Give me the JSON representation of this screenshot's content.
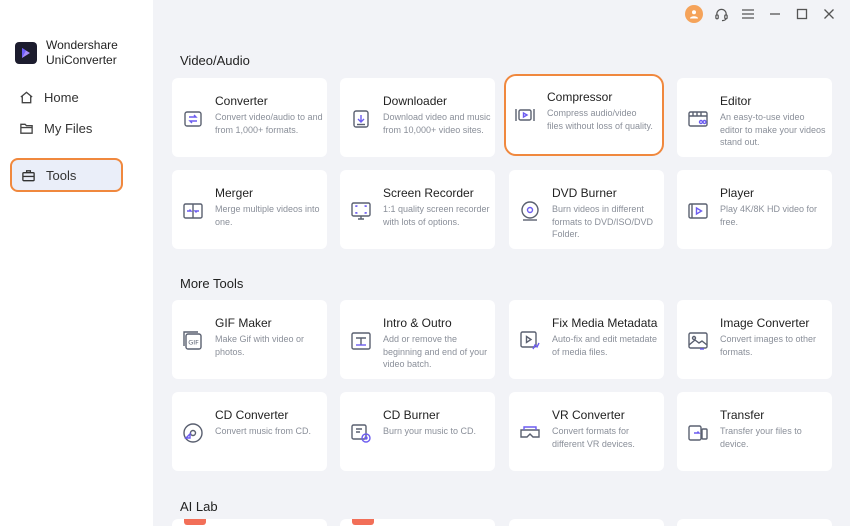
{
  "app": {
    "name_line1": "Wondershare",
    "name_line2": "UniConverter"
  },
  "sidebar": {
    "items": [
      {
        "label": "Home",
        "icon": "home-icon"
      },
      {
        "label": "My Files",
        "icon": "folder-icon"
      },
      {
        "label": "Tools",
        "icon": "toolbox-icon",
        "active": true
      }
    ]
  },
  "colors": {
    "accent": "#f0883e",
    "icon_stroke": "#5a6070",
    "icon_accent": "#6c5cf0"
  },
  "sections": {
    "video_audio": "Video/Audio",
    "more_tools": "More Tools",
    "ai_lab": "AI Lab"
  },
  "tools": {
    "converter": {
      "title": "Converter",
      "desc": "Convert video/audio to and from 1,000+ formats."
    },
    "downloader": {
      "title": "Downloader",
      "desc": "Download video and music from 10,000+ video sites."
    },
    "compressor": {
      "title": "Compressor",
      "desc": "Compress audio/video files without loss of quality."
    },
    "editor": {
      "title": "Editor",
      "desc": "An easy-to-use video editor to make your videos stand out."
    },
    "merger": {
      "title": "Merger",
      "desc": "Merge multiple videos into one."
    },
    "screen_recorder": {
      "title": "Screen Recorder",
      "desc": "1:1 quality screen recorder with lots of options."
    },
    "dvd_burner": {
      "title": "DVD Burner",
      "desc": "Burn videos in different formats to DVD/ISO/DVD Folder."
    },
    "player": {
      "title": "Player",
      "desc": "Play 4K/8K HD video for free."
    },
    "gif_maker": {
      "title": "GIF Maker",
      "desc": "Make Gif with video or photos."
    },
    "intro_outro": {
      "title": "Intro & Outro",
      "desc": "Add or remove the beginning and end of your video batch."
    },
    "fix_media_metadata": {
      "title": "Fix Media Metadata",
      "desc": "Auto-fix and edit metadate of media files."
    },
    "image_converter": {
      "title": "Image Converter",
      "desc": "Convert images to other formats."
    },
    "cd_converter": {
      "title": "CD Converter",
      "desc": "Convert music from CD."
    },
    "cd_burner": {
      "title": "CD Burner",
      "desc": "Burn your music to CD."
    },
    "vr_converter": {
      "title": "VR Converter",
      "desc": "Convert formats for different VR devices."
    },
    "transfer": {
      "title": "Transfer",
      "desc": "Transfer your files to device."
    }
  },
  "icons": {
    "gif_badge": "GIF"
  }
}
